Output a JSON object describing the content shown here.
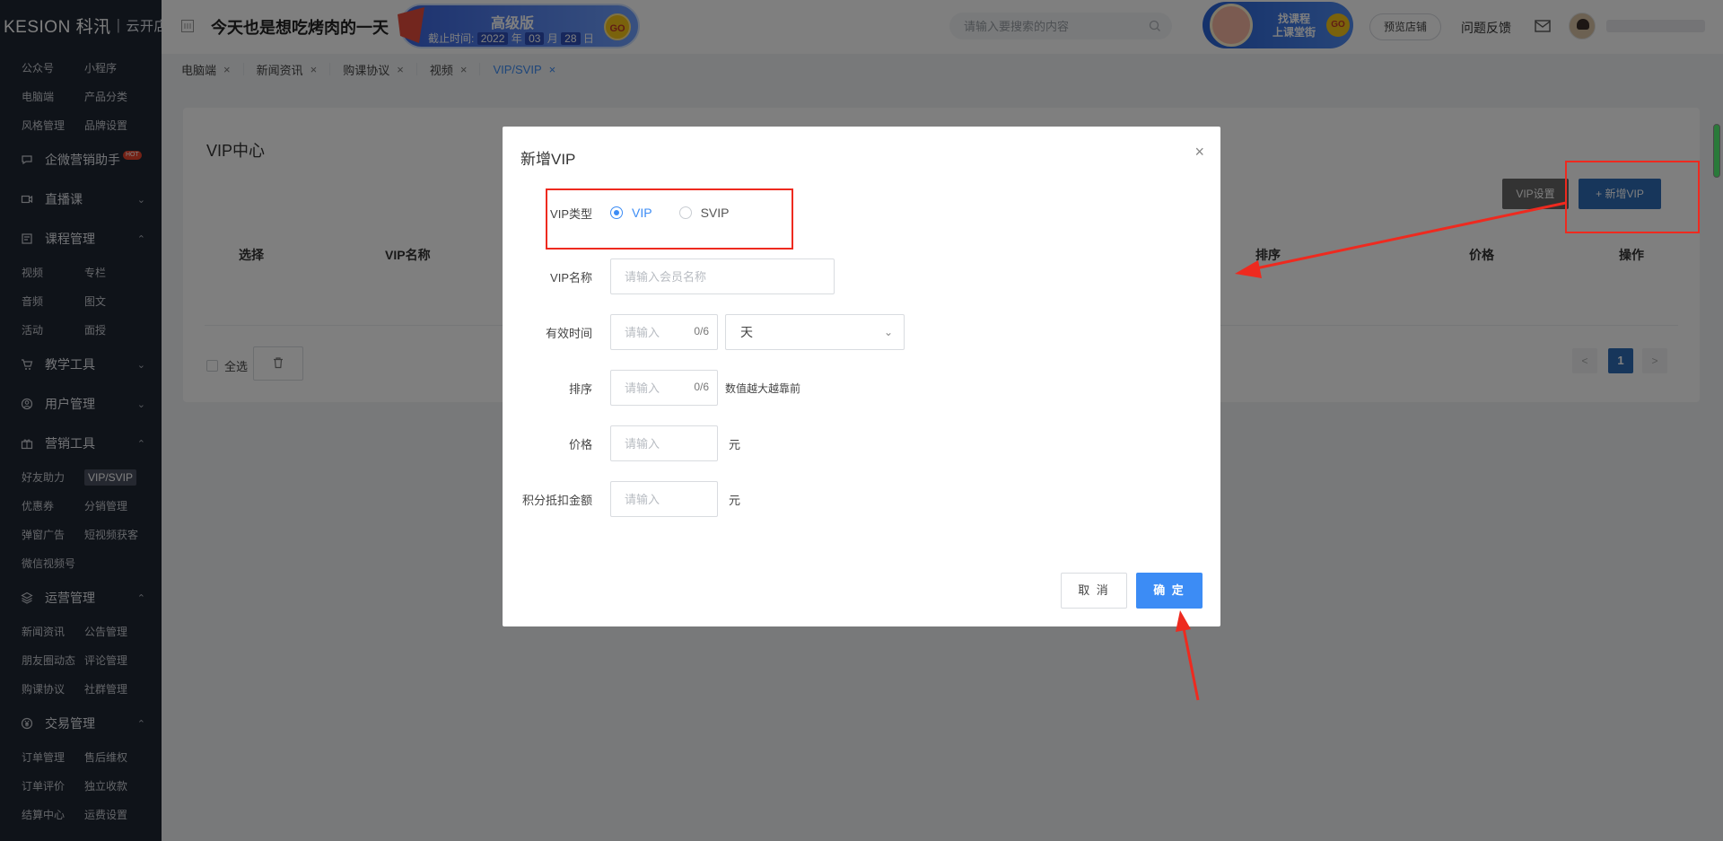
{
  "brand": {
    "logo": "KESION 科汛",
    "shop": "云开店"
  },
  "sidebar": {
    "top_items": [
      "公众号",
      "小程序",
      "电脑端",
      "产品分类",
      "风格管理",
      "品牌设置"
    ],
    "wecom": {
      "label": "企微营销助手",
      "badge": "HOT"
    },
    "live": "直播课",
    "course": {
      "label": "课程管理",
      "items": [
        "视频",
        "专栏",
        "音频",
        "图文",
        "活动",
        "面授"
      ]
    },
    "teach": "教学工具",
    "user": "用户管理",
    "marketing": {
      "label": "营销工具",
      "items": [
        "好友助力",
        "VIP/SVIP",
        "优惠券",
        "分销管理",
        "弹窗广告",
        "短视频获客",
        "微信视频号"
      ]
    },
    "ops": {
      "label": "运营管理",
      "items": [
        "新闻资讯",
        "公告管理",
        "朋友圈动态",
        "评论管理",
        "购课协议",
        "社群管理"
      ]
    },
    "trade": {
      "label": "交易管理",
      "items": [
        "订单管理",
        "售后维权",
        "订单评价",
        "独立收款",
        "结算中心",
        "运费设置"
      ]
    }
  },
  "header": {
    "site_title": "今天也是想吃烤肉的一天",
    "edition": {
      "title": "高级版",
      "expire_label": "截止时间:",
      "year": "2022",
      "year_unit": "年",
      "month": "03",
      "month_unit": "月",
      "day": "28",
      "day_unit": "日",
      "go": "GO"
    },
    "search_placeholder": "请输入要搜索的内容",
    "promo": {
      "line1": "找课程",
      "line2": "上课堂街",
      "go": "GO"
    },
    "preview_button": "预览店铺",
    "feedback": "问题反馈"
  },
  "tabs": [
    {
      "label": "电脑端"
    },
    {
      "label": "新闻资讯"
    },
    {
      "label": "购课协议"
    },
    {
      "label": "视频"
    },
    {
      "label": "VIP/SVIP"
    }
  ],
  "page": {
    "title": "VIP中心",
    "vip_settings_button": "VIP设置",
    "add_vip_button": "+ 新增VIP",
    "columns": {
      "select": "选择",
      "name": "VIP名称",
      "sort": "排序",
      "price": "价格",
      "action": "操作"
    },
    "select_all": "全选",
    "pagination": {
      "prev": "<",
      "current": "1",
      "next": ">"
    }
  },
  "dialog": {
    "title": "新增VIP",
    "close": "×",
    "type_label": "VIP类型",
    "type_options": [
      "VIP",
      "SVIP"
    ],
    "type_selected": "VIP",
    "name_label": "VIP名称",
    "name_placeholder": "请输入会员名称",
    "duration_label": "有效时间",
    "duration_placeholder": "请输入",
    "duration_counter": "0/6",
    "duration_unit": "天",
    "sort_label": "排序",
    "sort_placeholder": "请输入",
    "sort_counter": "0/6",
    "sort_hint": "数值越大越靠前",
    "price_label": "价格",
    "price_placeholder": "请输入",
    "price_unit": "元",
    "points_label": "积分抵扣金额",
    "points_placeholder": "请输入",
    "points_unit": "元",
    "cancel_button": "取 消",
    "confirm_button": "确 定"
  },
  "colors": {
    "primary": "#3c8cf5",
    "sidebar_bg": "#1f2633",
    "annotation": "#ee2a1f"
  }
}
